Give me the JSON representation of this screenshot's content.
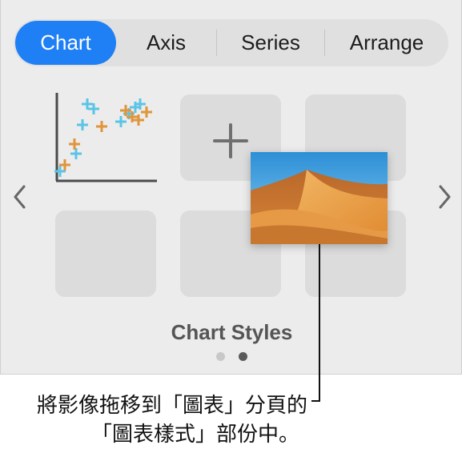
{
  "tabs": [
    {
      "label": "Chart",
      "active": true
    },
    {
      "label": "Axis",
      "active": false
    },
    {
      "label": "Series",
      "active": false
    },
    {
      "label": "Arrange",
      "active": false
    }
  ],
  "section_title": "Chart Styles",
  "pagination": {
    "total": 2,
    "current": 2
  },
  "add_style_icon": "plus-icon",
  "dragged_image_subject": "desert-sand-dunes-photo",
  "caption": {
    "line1": "將影像拖移到「圖表」分頁的",
    "line2": "「圖表樣式」部份中。"
  },
  "colors": {
    "accent": "#1f7ff5",
    "series_blue": "#5bc4e6",
    "series_orange": "#e0953a"
  }
}
